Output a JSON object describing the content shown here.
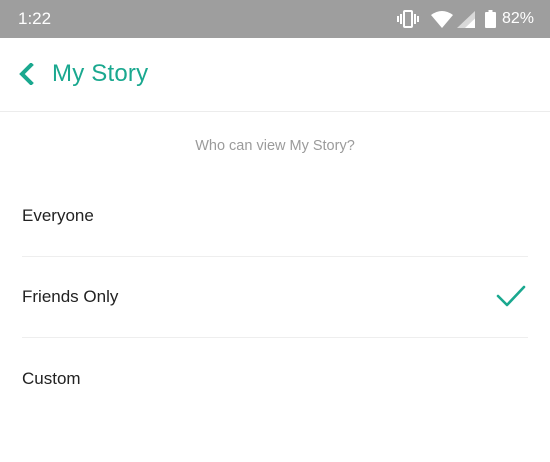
{
  "status_bar": {
    "time": "1:22",
    "battery_percent": "82%",
    "icons": [
      "vibrate-icon",
      "wifi-icon",
      "cell-signal-icon",
      "battery-icon"
    ]
  },
  "header": {
    "title": "My Story",
    "back_icon": "chevron-left-icon"
  },
  "question": "Who can view My Story?",
  "options": [
    {
      "label": "Everyone",
      "selected": false
    },
    {
      "label": "Friends Only",
      "selected": true
    },
    {
      "label": "Custom",
      "selected": false
    }
  ],
  "colors": {
    "accent": "#1aa88f",
    "status_bar": "#9e9e9e",
    "text": "#222222",
    "muted_text": "#9b9b9b"
  }
}
